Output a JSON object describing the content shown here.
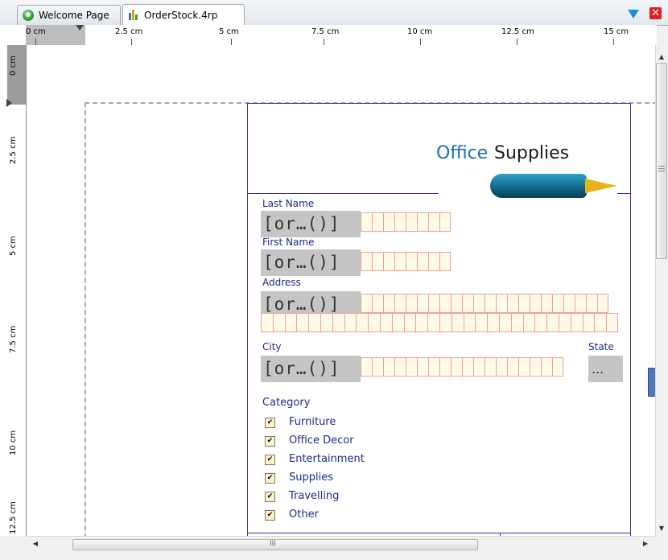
{
  "tabs": [
    {
      "label": "Welcome Page",
      "icon": "globe-icon"
    },
    {
      "label": "OrderStock.4rp",
      "icon": "report-document-icon",
      "active": true
    }
  ],
  "ruler": {
    "horizontal": [
      "0 cm",
      "2.5 cm",
      "5 cm",
      "7.5 cm",
      "10 cm",
      "12.5 cm",
      "15 cm"
    ],
    "vertical": [
      "0 cm",
      "2.5 cm",
      "5 cm",
      "7.5 cm",
      "10 cm",
      "12.5 cm"
    ]
  },
  "logo": {
    "word1": "Office",
    "word2": "Supplies",
    "accent": "#1c6fb3"
  },
  "form": {
    "last_name_label": "Last Name",
    "first_name_label": "First Name",
    "address_label": "Address",
    "city_label": "City",
    "state_label": "State",
    "field_placeholder": "[or…()]",
    "state_value": "...",
    "category_label": "Category",
    "categories": [
      "Furniture",
      "Office Decor",
      "Entertainment",
      "Supplies",
      "Travelling",
      "Other"
    ],
    "checkbox_mark": "✔"
  },
  "scrollbar": {
    "thumb_grip": "III"
  },
  "colors": {
    "form_line": "#3236a3",
    "label_text": "#1e2a8a",
    "cell_border": "#f0a0a0"
  }
}
